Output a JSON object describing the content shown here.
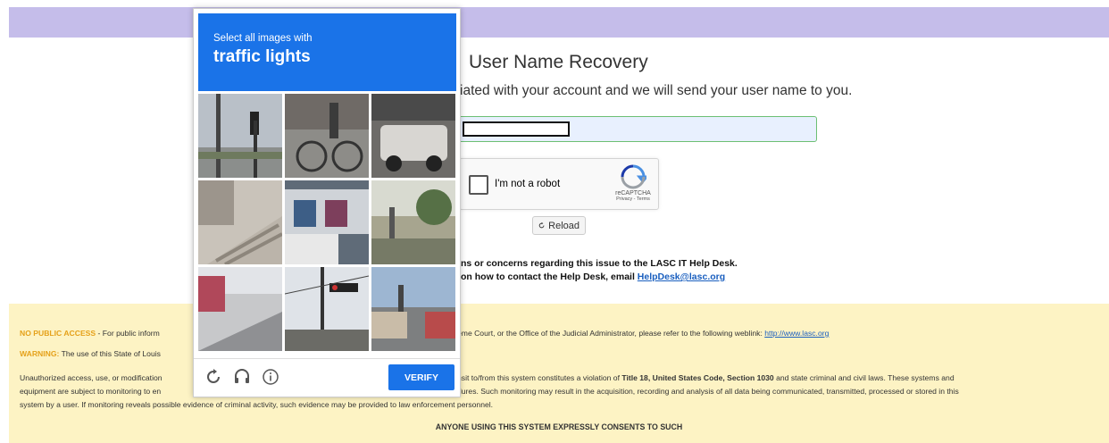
{
  "page": {
    "title": "User Name Recovery",
    "instructions": "iated with your account and we will send your user name to you."
  },
  "email_field": {
    "value": ""
  },
  "recaptcha": {
    "checkbox_label": "I'm not a robot",
    "brand": "reCAPTCHA",
    "links": "Privacy - Terms"
  },
  "reload_button": {
    "label": "Reload",
    "icon": "reload-icon"
  },
  "help": {
    "line1": "ns or concerns regarding this issue to the LASC IT Help Desk.",
    "line2_prefix": "on how to contact the Help Desk, email ",
    "email": "HelpDesk@lasc.org"
  },
  "footer": {
    "no_public_access_label": "NO PUBLIC ACCESS",
    "no_public_access_text": " - For public inform",
    "no_public_access_text2": "eme Court, or the Office of the Judicial Administrator, please refer to the following weblink: ",
    "weblink": "http://www.lasc.org",
    "warning_label": "WARNING:",
    "warning_text": " The use of this State of Louis",
    "para_a": "Unauthorized access, use, or modification",
    "para_b": "nsit to/from this system constitutes a violation of ",
    "para_bold1": "Title 18, United States Code, Section 1030",
    "para_c": " and state criminal and civil laws. These systems and",
    "para_line2a": "equipment are subject to monitoring to en",
    "para_line2b": "dures. Such monitoring may result in the acquisition, recording and analysis of all data being communicated, transmitted, processed or stored in this",
    "para_line3": "system by a user. If monitoring reveals possible evidence of criminal activity, such evidence may be provided to law enforcement personnel.",
    "consent": "ANYONE USING THIS SYSTEM EXPRESSLY CONSENTS TO SUCH"
  },
  "challenge": {
    "prompt_small": "Select all images with",
    "prompt_big": "traffic lights",
    "verify_label": "VERIFY",
    "icons": [
      "reload-challenge-icon",
      "audio-icon",
      "info-icon"
    ],
    "colors": {
      "header": "#1a73e8",
      "verify": "#1a73e8"
    }
  },
  "colors": {
    "top_bar": "#c5bdea",
    "footer_bg": "#fdf3c4",
    "warning": "#e5a11a",
    "link": "#1a5fbf"
  }
}
